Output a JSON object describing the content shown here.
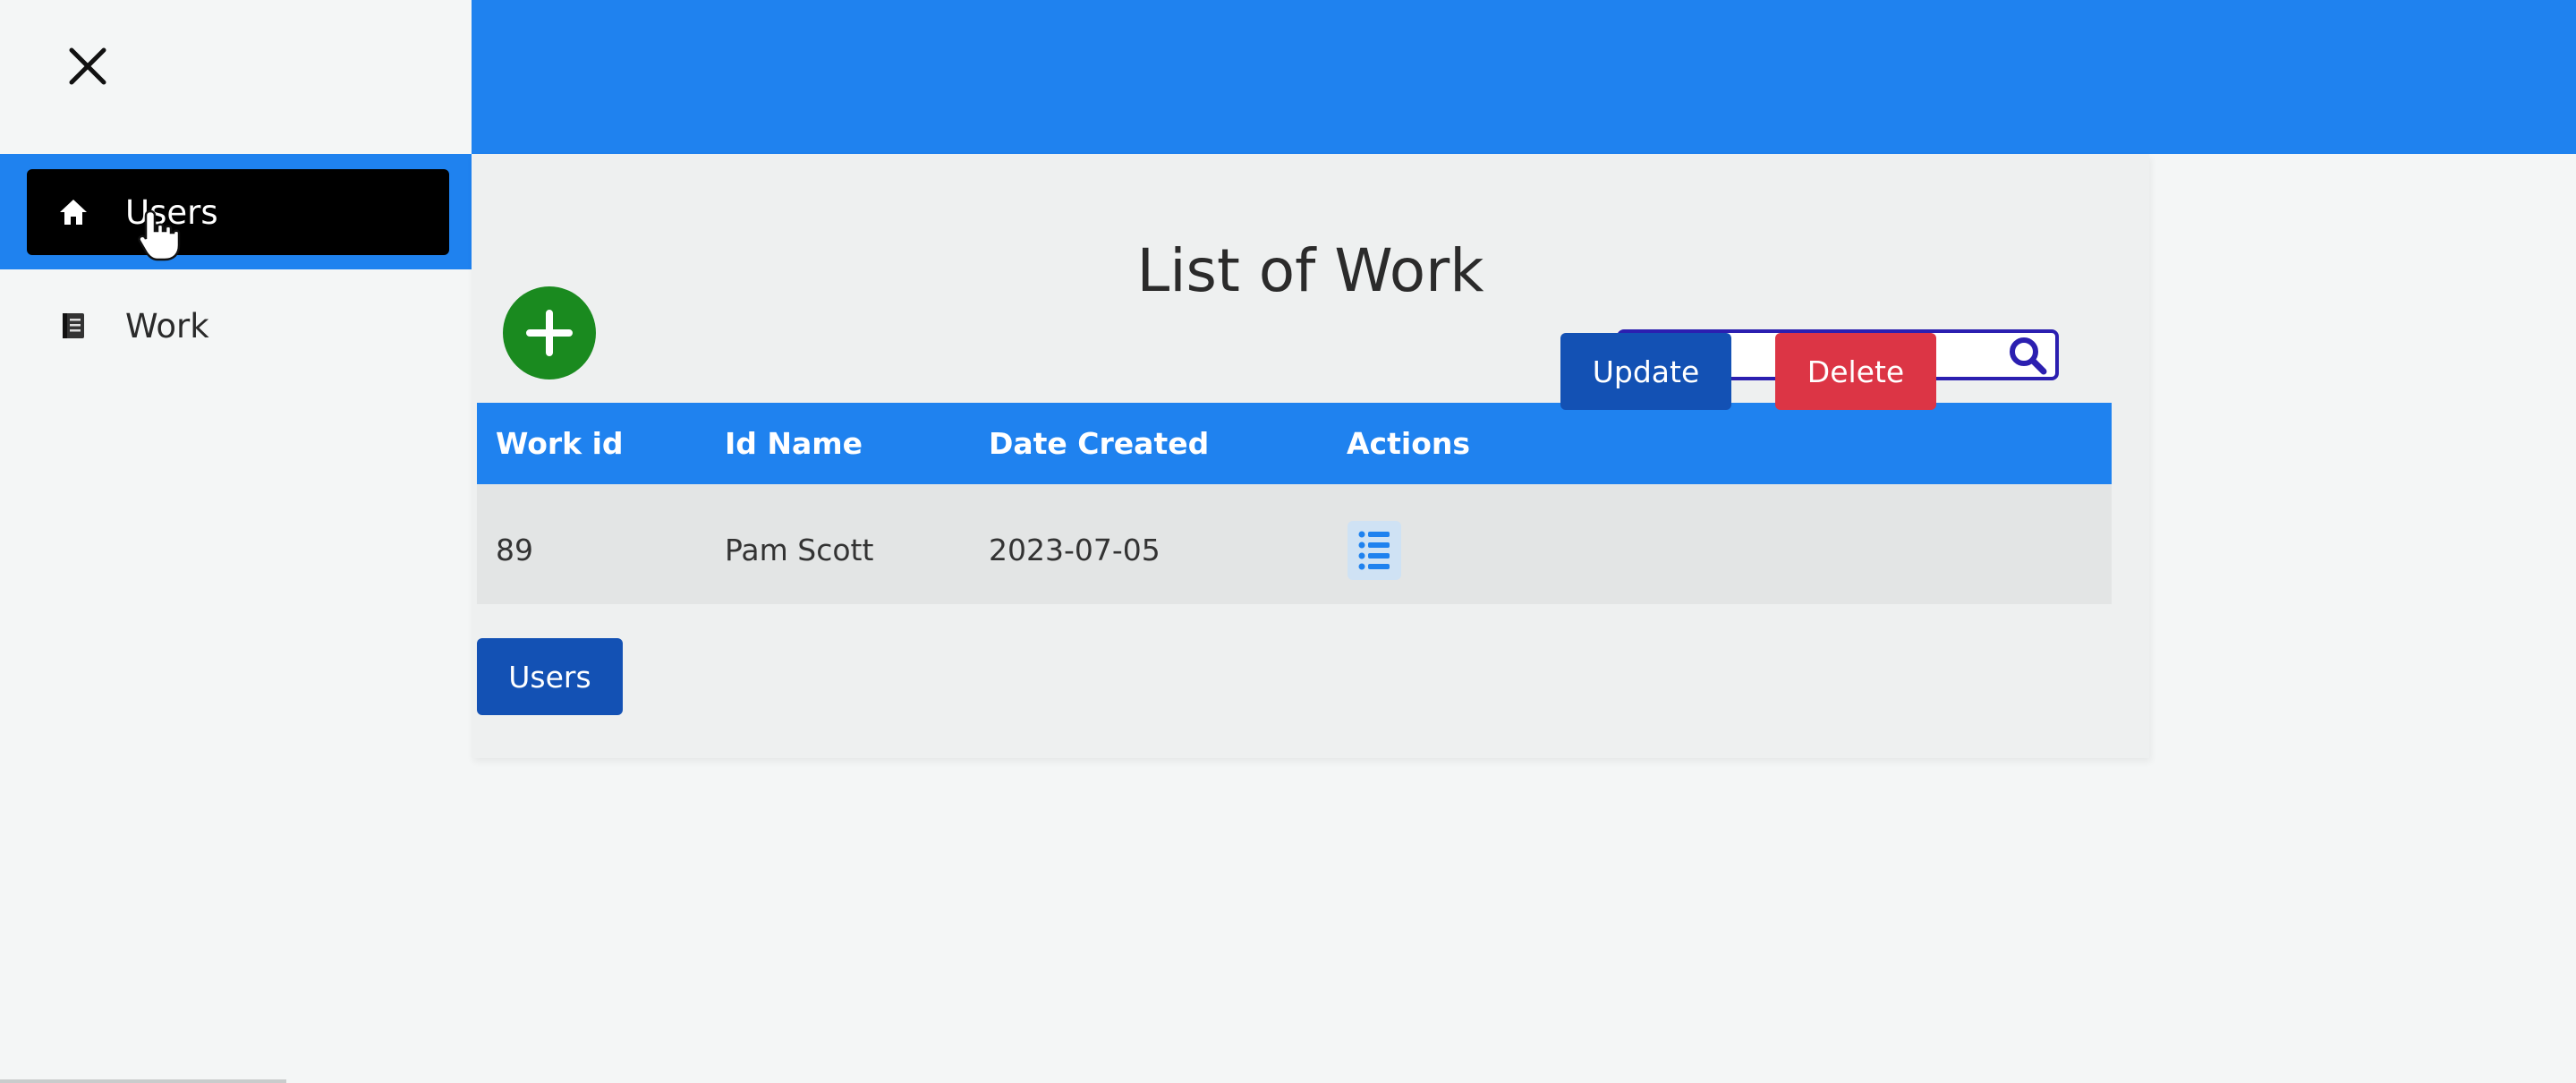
{
  "sidebar": {
    "items": [
      {
        "label": "Users",
        "icon": "home-icon",
        "active": true
      },
      {
        "label": "Work",
        "icon": "book-icon",
        "active": false
      }
    ]
  },
  "main": {
    "title": "List of Work",
    "search": {
      "placeholder": "search",
      "value": ""
    },
    "table": {
      "headers": [
        "Work id",
        "Id Name",
        "Date Created",
        "Actions"
      ],
      "rows": [
        {
          "work_id": "89",
          "id_name": "Pam Scott",
          "date_created": "2023-07-05"
        }
      ]
    },
    "row_actions": {
      "update_label": "Update",
      "delete_label": "Delete"
    },
    "users_button_label": "Users"
  },
  "colors": {
    "accent": "#1f82ef",
    "add_button": "#1a8a1f",
    "update_button": "#1351b4",
    "delete_button": "#dc3545",
    "active_nav": "#000000"
  }
}
